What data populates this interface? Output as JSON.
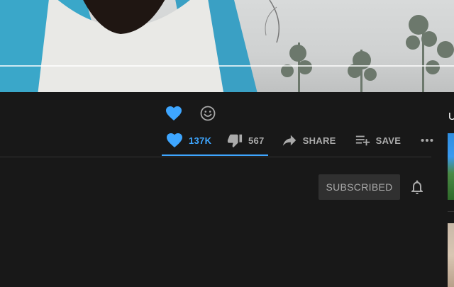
{
  "video": {
    "label": ""
  },
  "reactions": [
    {
      "icon": "heart-icon",
      "color": "#3ea6ff"
    },
    {
      "icon": "smiley-icon",
      "color": "#aaaaaa"
    }
  ],
  "actions": {
    "like": {
      "icon": "heart-icon",
      "count": "137K",
      "active": true
    },
    "dislike": {
      "icon": "thumbs-down-icon",
      "count": "567"
    },
    "share": {
      "icon": "share-arrow-icon",
      "label": "SHARE"
    },
    "save": {
      "icon": "playlist-add-icon",
      "label": "SAVE"
    },
    "more": {
      "icon": "more-horizontal-icon"
    }
  },
  "channel": {
    "subscribe_label": "SUBSCRIBED",
    "bell_icon": "bell-icon"
  },
  "sidebar": {
    "heading": "U"
  },
  "colors": {
    "accent": "#3ea6ff",
    "background": "#181818",
    "muted": "#aaaaaa",
    "button_bg": "#303030"
  }
}
